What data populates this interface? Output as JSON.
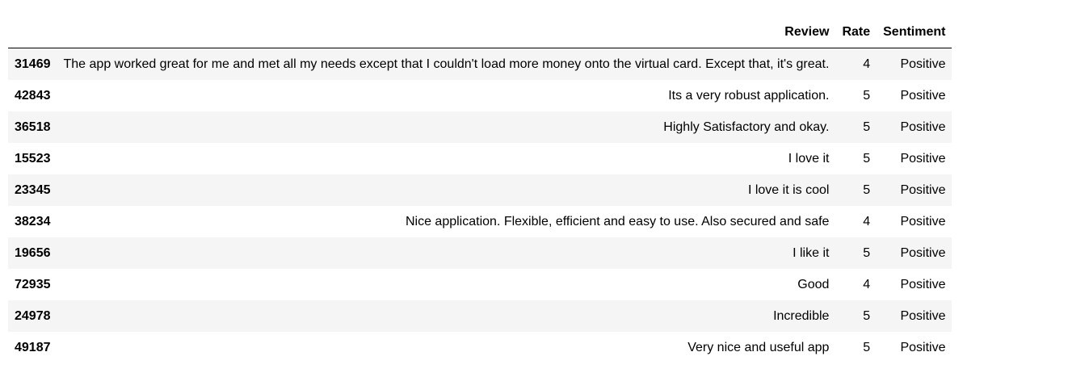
{
  "columns": {
    "index": "",
    "review": "Review",
    "rate": "Rate",
    "sentiment": "Sentiment"
  },
  "rows": [
    {
      "id": "31469",
      "review": "The app worked great for me and met all my needs except that I couldn't load more money onto the virtual card. Except that, it's great.",
      "rate": "4",
      "sentiment": "Positive"
    },
    {
      "id": "42843",
      "review": "Its a very robust application.",
      "rate": "5",
      "sentiment": "Positive"
    },
    {
      "id": "36518",
      "review": "Highly Satisfactory and okay.",
      "rate": "5",
      "sentiment": "Positive"
    },
    {
      "id": "15523",
      "review": "I love it",
      "rate": "5",
      "sentiment": "Positive"
    },
    {
      "id": "23345",
      "review": "I love it is cool",
      "rate": "5",
      "sentiment": "Positive"
    },
    {
      "id": "38234",
      "review": "Nice application. Flexible, efficient and easy to use. Also secured and safe",
      "rate": "4",
      "sentiment": "Positive"
    },
    {
      "id": "19656",
      "review": "I like it",
      "rate": "5",
      "sentiment": "Positive"
    },
    {
      "id": "72935",
      "review": "Good",
      "rate": "4",
      "sentiment": "Positive"
    },
    {
      "id": "24978",
      "review": "Incredible",
      "rate": "5",
      "sentiment": "Positive"
    },
    {
      "id": "49187",
      "review": "Very nice and useful app",
      "rate": "5",
      "sentiment": "Positive"
    }
  ]
}
